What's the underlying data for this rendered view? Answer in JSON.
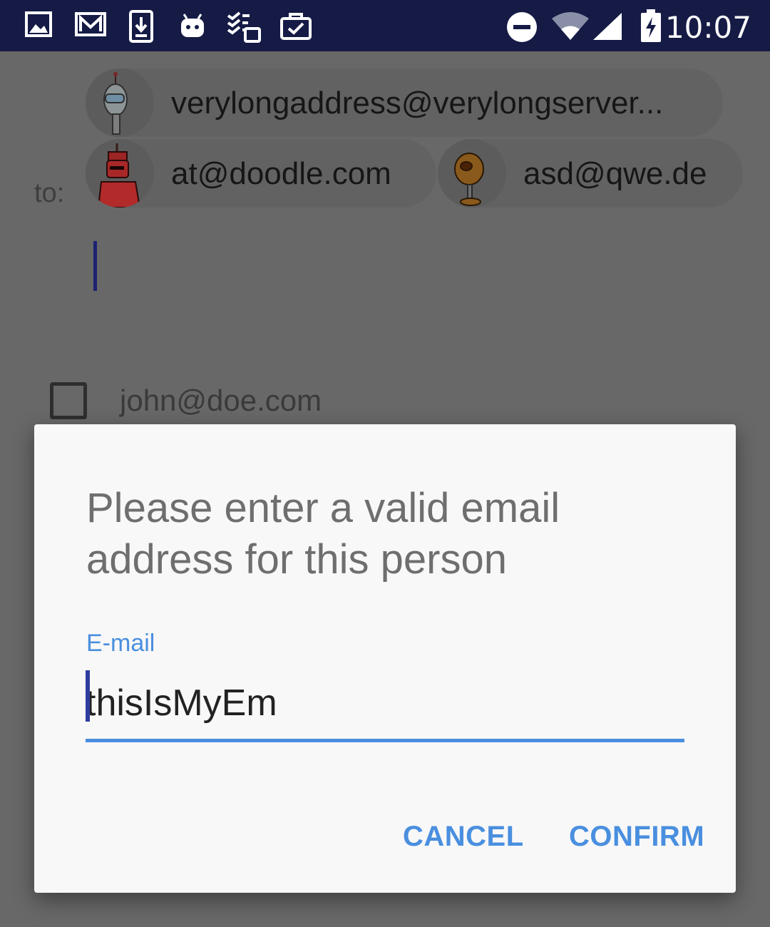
{
  "status_bar": {
    "time": "10:07",
    "icons": [
      "image-icon",
      "gmail-icon",
      "download-icon",
      "android-icon",
      "todoist-icon",
      "task-icon",
      "do-not-disturb-icon",
      "wifi-icon",
      "signal-icon",
      "battery-charging-icon"
    ]
  },
  "compose": {
    "to_label": "to:",
    "chips": [
      {
        "email": "verylongaddress@verylongserver..."
      },
      {
        "email": "at@doodle.com"
      },
      {
        "email": "asd@qwe.de"
      }
    ]
  },
  "list": {
    "items": [
      {
        "email": "john@doe.com",
        "checked": false
      }
    ]
  },
  "dialog": {
    "title": "Please enter a valid email address for this person",
    "field_label": "E-mail",
    "field_value": "thisIsMyEm",
    "cancel_label": "CANCEL",
    "confirm_label": "CONFIRM"
  },
  "colors": {
    "status_bar": "#151b45",
    "accent": "#4a8fdf",
    "scrim_background": "#686868",
    "dialog_background": "#f8f8f8"
  }
}
